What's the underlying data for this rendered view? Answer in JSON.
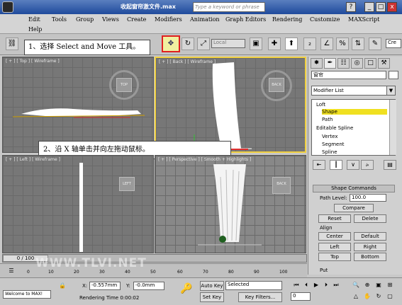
{
  "titlebar": {
    "title": "收起窗帘激文件.max",
    "search_placeholder": "Type a keyword or phrase",
    "help_btn": "?",
    "min_btn": "_",
    "max_btn": "□",
    "close_btn": "x"
  },
  "menu": {
    "items": [
      "Edit",
      "Tools",
      "Group",
      "Views",
      "Create",
      "Modifiers",
      "Animation",
      "Graph Editors",
      "Rendering",
      "Customize",
      "MAXScript",
      "Help"
    ]
  },
  "toolbar": {
    "refcoord": "Local",
    "named_sel": "Cre"
  },
  "callouts": {
    "step1": "1、选择 Select and Move 工具。",
    "step2": "2、沿 X 轴单击并向左拖动鼠标。"
  },
  "viewports": {
    "top": {
      "label": "[ + ] [ Top ] [ Wireframe ]",
      "cube": "TOP"
    },
    "back": {
      "label": "[ + ] [ Back ] [ Wireframe ]",
      "cube": "BACK"
    },
    "left": {
      "label": "[ + ] [ Left ] [ Wireframe ]",
      "cube": "LEFT"
    },
    "persp": {
      "label": "[ + ] [ Perspective ] [ Smooth + Highlights ]",
      "cube": "BACK"
    }
  },
  "panel": {
    "object_name": "窗帘",
    "modifier_list": "Modifier List",
    "stack": [
      "Loft",
      "Shape",
      "Path",
      "Editable Spline",
      "Vertex",
      "Segment",
      "Spline"
    ],
    "shape_commands": {
      "title": "Shape Commands",
      "path_level_label": "Path Level:",
      "path_level_value": "100.0",
      "compare": "Compare",
      "reset": "Reset",
      "delete": "Delete",
      "align": "Align",
      "center": "Center",
      "default": "Default",
      "left": "Left",
      "right": "Right",
      "top": "Top",
      "bottom": "Bottom",
      "put": "Put"
    }
  },
  "timeline": {
    "frame": "0 / 100",
    "ticks": [
      "0",
      "10",
      "20",
      "30",
      "40",
      "50",
      "60",
      "70",
      "80",
      "90",
      "100"
    ],
    "progress": 0.0
  },
  "status": {
    "welcome": "Welcome to MAX!",
    "x_label": "X:",
    "x_value": "-0.557mm",
    "y_label": "Y:",
    "y_value": "-0.0mm",
    "auto_key": "Auto Key",
    "set_key": "Set Key",
    "selected": "Selected",
    "key_filters": "Key Filters...",
    "rendering_time": "Rendering Time  0:00:02",
    "frame_field": "0"
  },
  "watermark": "WWW.TLVI.NET"
}
